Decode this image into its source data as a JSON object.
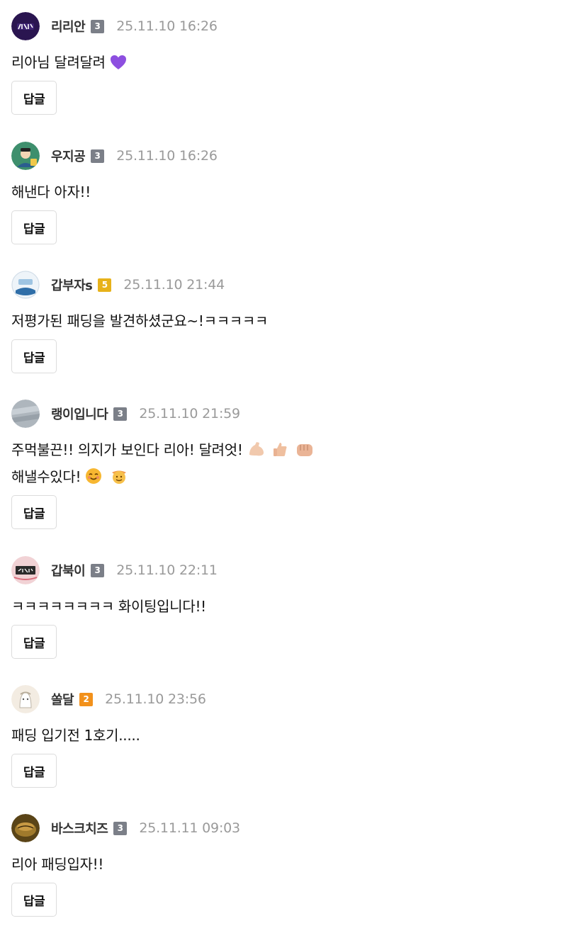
{
  "colors": {
    "level_badge_gray": "#7b7f88",
    "level_badge_gold": "#e7b21a",
    "level_badge_orange": "#f2911b",
    "date_text": "#9a9a9a",
    "heart": "#8d4fe0"
  },
  "reply_label": "답글",
  "comments": [
    {
      "nickname": "리리안",
      "level": "3",
      "date": "25.11.10 16:26",
      "text_lines": [
        "리아님 달려달려"
      ],
      "emojis": [
        "purple-heart-icon"
      ]
    },
    {
      "nickname": "우지공",
      "level": "3",
      "date": "25.11.10 16:26",
      "text_lines": [
        "해낸다 아자!!"
      ]
    },
    {
      "nickname": "갑부자s",
      "level": "5",
      "date": "25.11.10 21:44",
      "text_lines": [
        "저평가된 패딩을 발견하셨군요~!ㅋㅋㅋㅋㅋ"
      ]
    },
    {
      "nickname": "랭이입니다",
      "level": "3",
      "date": "25.11.10 21:59",
      "text_lines": [
        "주먹불끈!! 의지가 보인다 리아! 달려엇!",
        "해낼수있다!"
      ],
      "emojis": [
        "flexed-biceps-icon",
        "thumbs-up-icon",
        "fist-icon",
        "smiling-face-icon",
        "cowboy-face-icon"
      ]
    },
    {
      "nickname": "갑북이",
      "level": "3",
      "date": "25.11.10 22:11",
      "text_lines": [
        "ㅋㅋㅋㅋㅋㅋㅋㅋ 화이팅입니다!!"
      ]
    },
    {
      "nickname": "쏠달",
      "level": "2",
      "date": "25.11.10 23:56",
      "text_lines": [
        "패딩 입기전 1호기....."
      ]
    },
    {
      "nickname": "바스크치즈",
      "level": "3",
      "date": "25.11.11 09:03",
      "text_lines": [
        "리아 패딩입자!!"
      ]
    }
  ]
}
